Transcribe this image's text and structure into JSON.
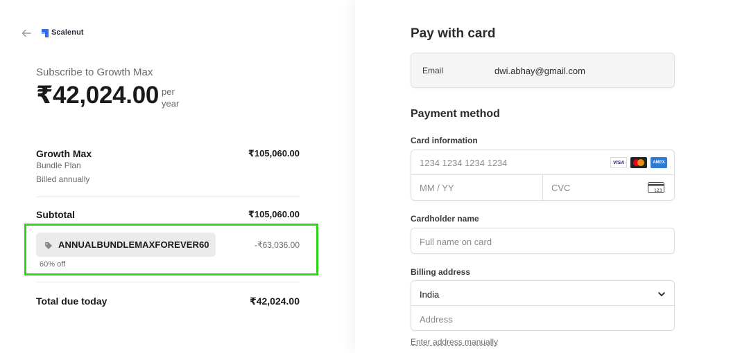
{
  "brand": {
    "name": "Scalenut",
    "logo_color": "#2c6cf5"
  },
  "summary": {
    "subscribe_title": "Subscribe to Growth Max",
    "price": "₹42,024.00",
    "price_unit": "per year"
  },
  "line_item": {
    "name": "Growth Max",
    "plan": "Bundle Plan",
    "billing": "Billed annually",
    "amount": "₹105,060.00"
  },
  "subtotal": {
    "label": "Subtotal",
    "amount": "₹105,060.00"
  },
  "promo": {
    "code": "ANNUALBUNDLEMAXFOREVER60",
    "discount": "-₹63,036.00",
    "off_text": "60% off",
    "highlight_color": "#2fd618"
  },
  "total": {
    "label": "Total due today",
    "amount": "₹42,024.00"
  },
  "payment": {
    "title": "Pay with card",
    "email_label": "Email",
    "email_value": "dwi.abhay@gmail.com",
    "method_title": "Payment method",
    "card_info_label": "Card information",
    "card_number_placeholder": "1234 1234 1234 1234",
    "expiry_placeholder": "MM / YY",
    "cvc_placeholder": "CVC",
    "card_brands": [
      "VISA",
      "mastercard",
      "AMEX"
    ],
    "cardholder_label": "Cardholder name",
    "cardholder_placeholder": "Full name on card",
    "billing_label": "Billing address",
    "country": "India",
    "address_placeholder": "Address",
    "manual_link": "Enter address manually"
  }
}
